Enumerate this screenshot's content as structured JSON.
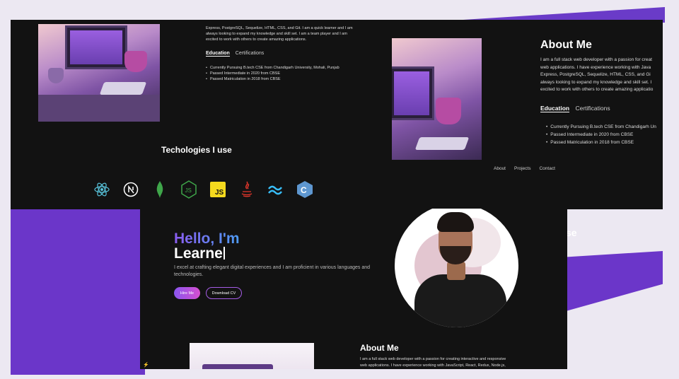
{
  "top": {
    "intro_lines": [
      "Express, PostgreSQL, Sequelize, HTML, CSS, and Git. I am a quick learner and I am",
      "always looking to expand my knowledge and skill set. I am a team player and I am",
      "excited to work with others to create amazing applications."
    ],
    "tabs": {
      "active": "Education",
      "other": "Certifications"
    },
    "education": [
      "Currently Pursuing B.tech CSE from Chandigarh University, Mohali, Punjab",
      "Passed Intermediate in 2020 from CBSE",
      "Passed Matriculation in 2018 from CBSE"
    ],
    "tech_title": "Techologies I use",
    "tech_icons": [
      "react-icon",
      "nextjs-icon",
      "mongodb-icon",
      "nodejs-icon",
      "javascript-icon",
      "java-icon",
      "tailwind-icon",
      "cpp-icon"
    ]
  },
  "about_right": {
    "title": "About Me",
    "lines": [
      "I am a full stack web developer with a passion for creat",
      "web applications. I have experience working with Java",
      "Express, PostgreSQL, Sequelize, HTML, CSS, and Gi",
      "always looking to expand my knowledge and skill set. I",
      "excited to work with others to create amazing applicatio"
    ],
    "tabs": {
      "active": "Education",
      "other": "Certifications"
    },
    "education": [
      "Currently Pursuing B.tech CSE from Chandigarh Un",
      "Passed Intermediate in 2020 from CBSE",
      "Passed Matriculation in 2018 from CBSE"
    ],
    "nav": [
      "About",
      "Projects",
      "Contact"
    ],
    "partial_heading": "se"
  },
  "hero": {
    "hello": "Hello, I'm",
    "name": "Learne",
    "intro": "I excel at crafting elegant digital experiences and I am proficient in various languages and technologies.",
    "hire_label": "Hire Me",
    "cv_label": "Download CV"
  },
  "about_bottom": {
    "title": "About Me",
    "lines": [
      "I am a full stack web developer with a passion for creating interactive and responsive",
      "web applications. I have experience working with JavaScript, React, Redux, Node.js,"
    ]
  },
  "colors": {
    "accent": "#6b36c9",
    "bg": "#121212"
  }
}
